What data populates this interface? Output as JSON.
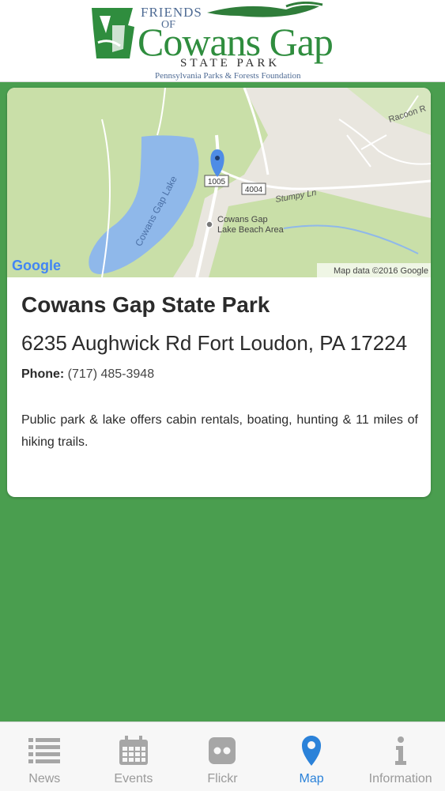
{
  "header": {
    "logo": {
      "friends": "FRIENDS",
      "of": "OF",
      "name": "Cowans Gap",
      "sub": "STATE PARK",
      "foundation": "Pennsylvania Parks & Forests Foundation"
    }
  },
  "map": {
    "road_label_racoon": "Racoon R",
    "route_1005": "1005",
    "route_4004": "4004",
    "road_stumpy": "Stumpy Ln",
    "lake_label": "Cowans Gap Lake",
    "poi_label_line1": "Cowans Gap",
    "poi_label_line2": "Lake Beach Area",
    "google_logo": "Google",
    "attribution": "Map data ©2016 Google"
  },
  "park": {
    "name": "Cowans Gap State Park",
    "address": "6235 Aughwick Rd Fort Loudon, PA 17224",
    "phone_label": "Phone:",
    "phone": "(717) 485-3948",
    "description": "Public park & lake offers cabin rentals, boating, hunting & 11 miles of hiking trails."
  },
  "tabs": [
    {
      "label": "News",
      "icon": "list-icon",
      "active": false
    },
    {
      "label": "Events",
      "icon": "calendar-icon",
      "active": false
    },
    {
      "label": "Flickr",
      "icon": "flickr-icon",
      "active": false
    },
    {
      "label": "Map",
      "icon": "map-pin-icon",
      "active": true
    },
    {
      "label": "Information",
      "icon": "info-icon",
      "active": false
    }
  ],
  "colors": {
    "background_green": "#4a9e4f",
    "active_tab": "#2b82d9",
    "inactive_tab": "#9a9a9a",
    "lake_blue": "#8fb8ea"
  }
}
